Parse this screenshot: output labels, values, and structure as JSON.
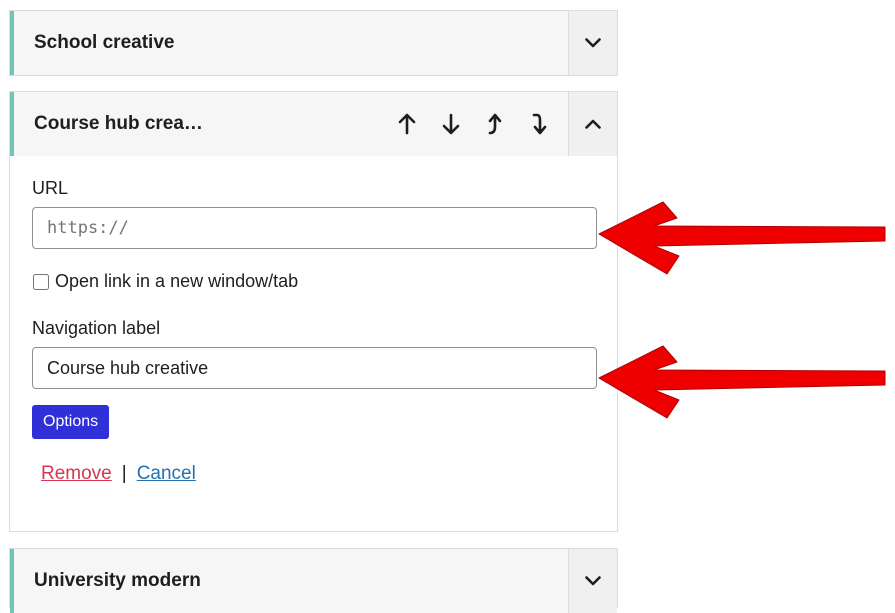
{
  "items": [
    {
      "title": "School creative"
    },
    {
      "title": "Course hub crea…"
    },
    {
      "title": "University modern"
    }
  ],
  "form": {
    "url_label": "URL",
    "url_placeholder": "https://",
    "new_tab_label": "Open link in a new window/tab",
    "nav_label": "Navigation label",
    "nav_value": "Course hub creative",
    "options_button": "Options",
    "remove_link": "Remove",
    "separator": "|",
    "cancel_link": "Cancel"
  },
  "icons": {
    "reorder": [
      "arrow-up-icon",
      "arrow-down-icon",
      "arrow-up-level-icon",
      "arrow-down-level-icon"
    ],
    "annotation": "red-arrow-annotation"
  },
  "colors": {
    "accent_border": "#72c4b8",
    "options_button": "#3030d8",
    "remove_link": "#d63651",
    "cancel_link": "#2271b1",
    "annotation_arrow": "#ee0000"
  }
}
